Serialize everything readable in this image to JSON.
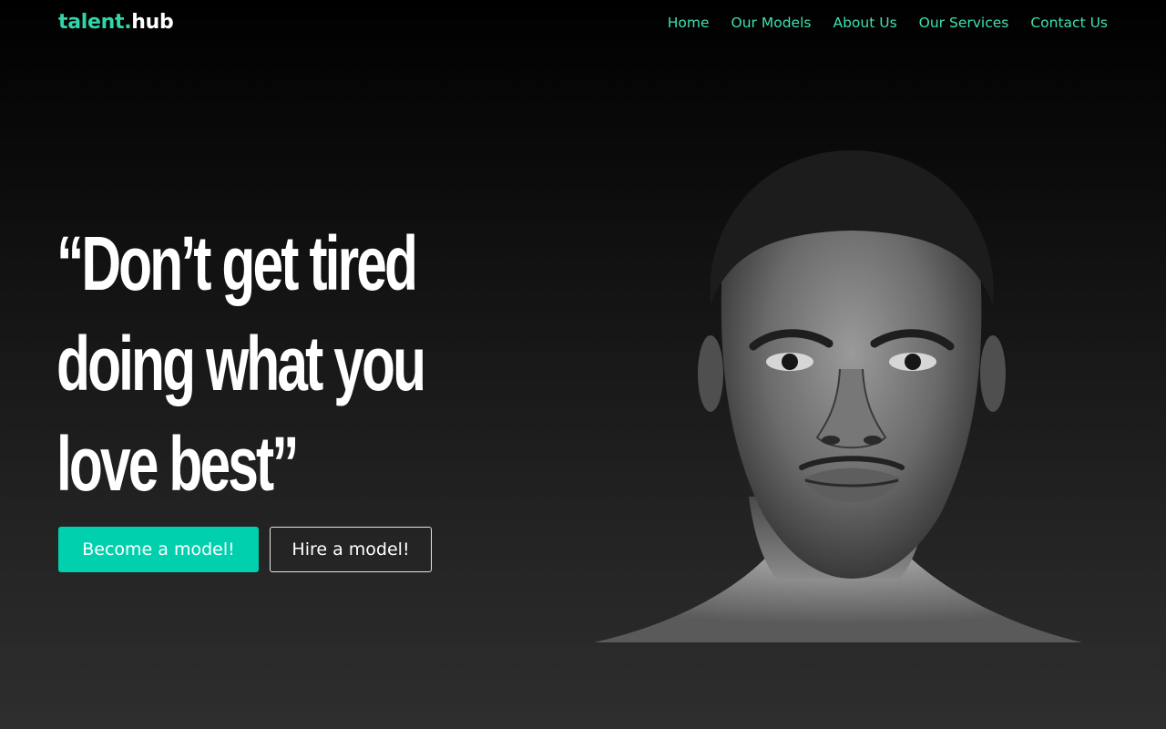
{
  "brand": {
    "part1": "talent.",
    "part2": "hub",
    "accent_color": "#2fd6a8"
  },
  "nav": {
    "items": [
      {
        "label": "Home"
      },
      {
        "label": "Our Models"
      },
      {
        "label": "About Us"
      },
      {
        "label": "Our Services"
      },
      {
        "label": "Contact Us"
      }
    ]
  },
  "hero": {
    "line1": "“Don’t get tired",
    "line2": "doing what you",
    "line3": "love best”",
    "primary_button": "Become a model!",
    "secondary_button": "Hire a model!",
    "primary_color": "#00d0ae"
  },
  "image": {
    "subject": "black-and-white portrait of a male model",
    "icon": "portrait-photo"
  }
}
